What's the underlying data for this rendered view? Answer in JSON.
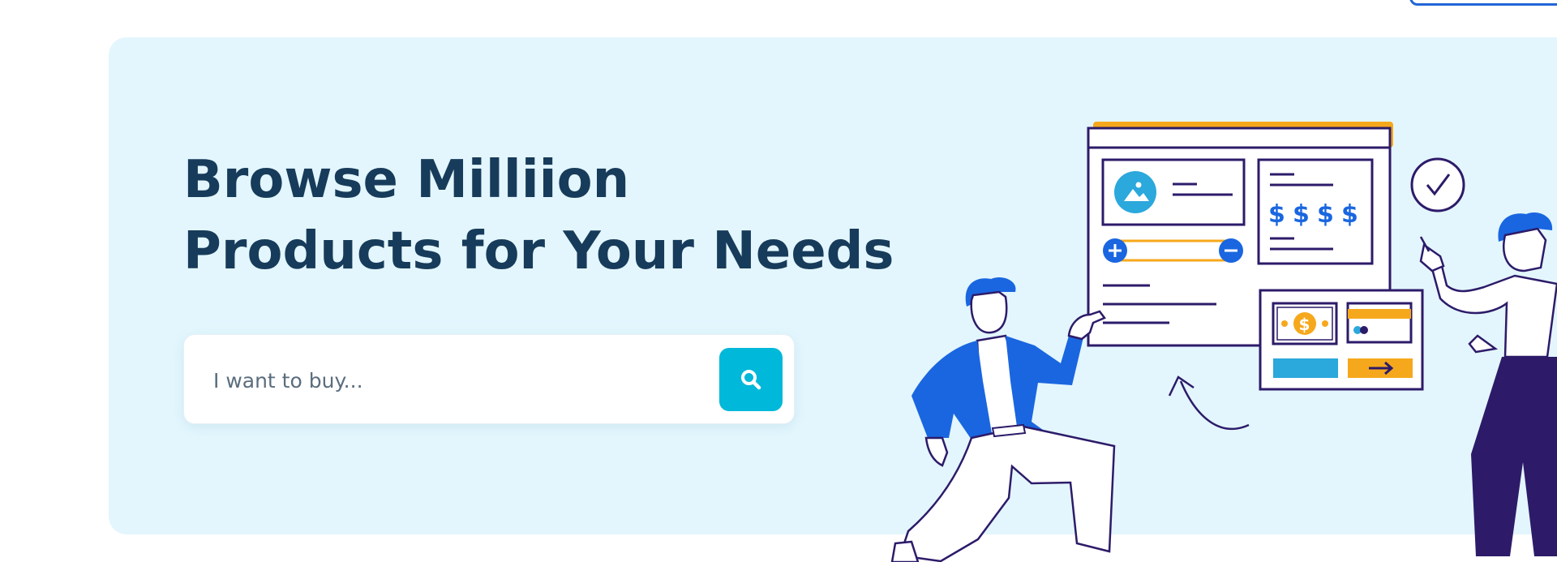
{
  "hero": {
    "title_line1": "Browse Milliion",
    "title_line2": "Products for Your Needs",
    "background_color": "#e3f6fd",
    "title_color": "#173b5a"
  },
  "search": {
    "placeholder": "I want to buy...",
    "button_icon": "search-icon",
    "button_color": "#00b8d9"
  },
  "illustration": {
    "price_symbols": [
      "$",
      "$",
      "$",
      "$"
    ],
    "bill_symbol": "$",
    "accent_color": "#f6a81c",
    "primary_color": "#1a66e0",
    "outline_color": "#2d1b69"
  }
}
